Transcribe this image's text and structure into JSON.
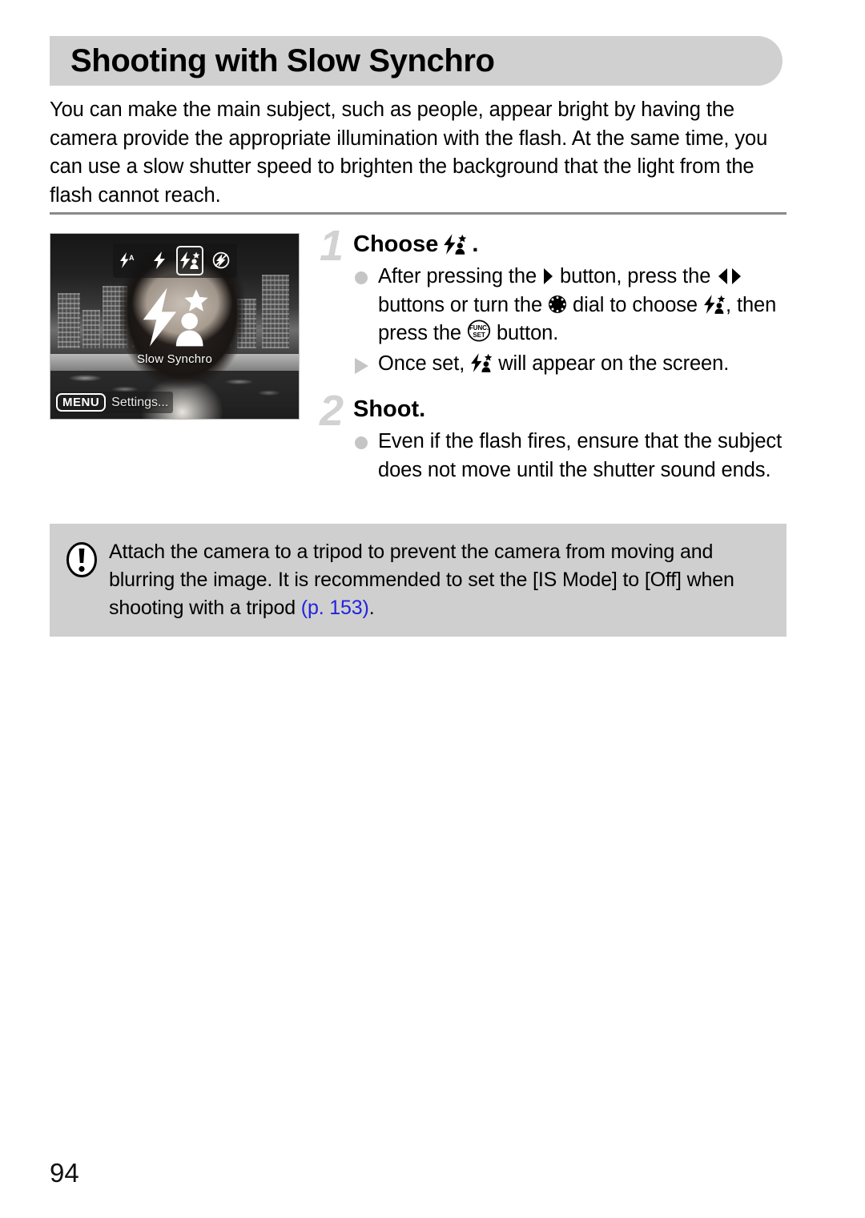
{
  "document": {
    "page_number": "94",
    "heading": "Shooting with Slow Synchro",
    "intro": "You can make the main subject, such as people, appear bright by having the camera provide the appropriate illumination with the flash. At the same time, you can use a slow shutter speed to brighten the background that the light from the flash cannot reach."
  },
  "camera_screen": {
    "mode_caption": "Slow Synchro",
    "menu_key_label": "MENU",
    "menu_hint_text": "Settings...",
    "flash_modes": [
      {
        "name": "flash-auto-icon",
        "label": "Flash Auto",
        "selected": false
      },
      {
        "name": "flash-on-icon",
        "label": "Flash On",
        "selected": false
      },
      {
        "name": "slow-synchro-icon",
        "label": "Slow Synchro",
        "selected": true
      },
      {
        "name": "flash-off-icon",
        "label": "Flash Off",
        "selected": false
      }
    ]
  },
  "steps": [
    {
      "number": "1",
      "heading_prefix": "Choose",
      "heading_suffix": ".",
      "heading_icon": "slow-synchro-icon",
      "lines": [
        {
          "marker": "dot",
          "segments": [
            {
              "type": "text",
              "value": "After pressing the "
            },
            {
              "type": "icon",
              "value": "right-button-icon"
            },
            {
              "type": "text",
              "value": " button, press the "
            },
            {
              "type": "icon",
              "value": "left-right-buttons-icon"
            },
            {
              "type": "text",
              "value": " buttons or turn the "
            },
            {
              "type": "icon",
              "value": "control-dial-icon"
            },
            {
              "type": "text",
              "value": " dial to choose "
            },
            {
              "type": "icon",
              "value": "slow-synchro-icon"
            },
            {
              "type": "text",
              "value": ", then press the "
            },
            {
              "type": "icon",
              "value": "func-set-button-icon"
            },
            {
              "type": "text",
              "value": " button."
            }
          ]
        },
        {
          "marker": "triangle",
          "segments": [
            {
              "type": "text",
              "value": "Once set, "
            },
            {
              "type": "icon",
              "value": "slow-synchro-icon"
            },
            {
              "type": "text",
              "value": " will appear on the screen."
            }
          ]
        }
      ]
    },
    {
      "number": "2",
      "heading_prefix": "Shoot.",
      "heading_suffix": "",
      "heading_icon": null,
      "lines": [
        {
          "marker": "dot",
          "segments": [
            {
              "type": "text",
              "value": "Even if the flash fires, ensure that the subject does not move until the shutter sound ends."
            }
          ]
        }
      ]
    }
  ],
  "note": {
    "icon": "caution-exclamation-icon",
    "text_before_link": "Attach the camera to a tripod to prevent the camera from moving and blurring the image. It is recommended to set the [IS Mode] to [Off] when shooting with a tripod ",
    "link_text": "(p. 153)",
    "text_after_link": "."
  },
  "colors": {
    "header_band": "#d0d0d0",
    "note_background": "#cfcfcf",
    "step_number": "#d2d2d2",
    "marker_gray": "#c5c5c5",
    "link_blue": "#2222dd",
    "divider": "#8a8a8a"
  }
}
